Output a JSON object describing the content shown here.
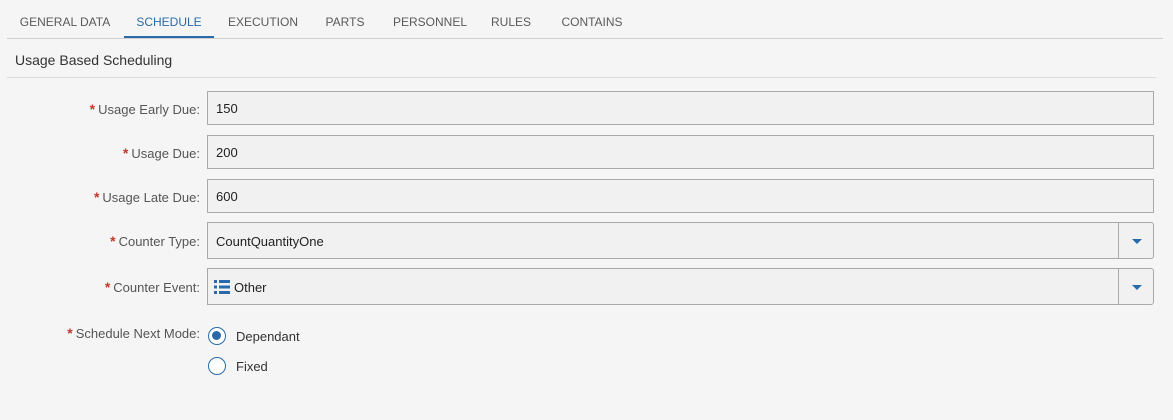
{
  "tabs": {
    "general_data": "GENERAL DATA",
    "schedule": "SCHEDULE",
    "execution": "EXECUTION",
    "parts": "PARTS",
    "personnel": "PERSONNEL",
    "rules": "RULES",
    "contains": "CONTAINS",
    "active": "SCHEDULE"
  },
  "section": {
    "title": "Usage Based Scheduling"
  },
  "required_mark": "*",
  "form": {
    "usage_early_due": {
      "label": "Usage Early Due:",
      "value": "150"
    },
    "usage_due": {
      "label": "Usage Due:",
      "value": "200"
    },
    "usage_late_due": {
      "label": "Usage Late Due:",
      "value": "600"
    },
    "counter_type": {
      "label": "Counter Type:",
      "value": "CountQuantityOne"
    },
    "counter_event": {
      "label": "Counter Event:",
      "value": "Other"
    },
    "schedule_next_mode": {
      "label": "Schedule Next Mode:",
      "options": [
        "Dependant",
        "Fixed"
      ],
      "selected": "Dependant"
    }
  },
  "colors": {
    "accent": "#2a6aa8",
    "required": "#c0392b"
  },
  "icons": {
    "dropdown": "chevron-down-icon",
    "event_type": "list-icon"
  }
}
